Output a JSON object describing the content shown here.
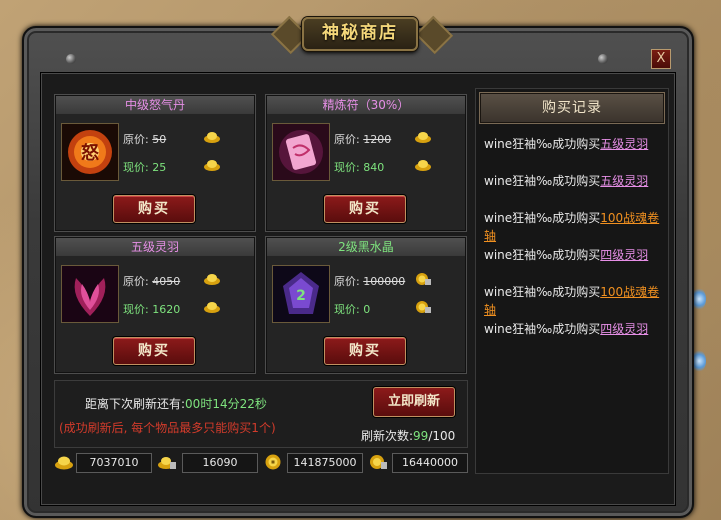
{
  "window": {
    "title": "神秘商店",
    "close_label": "X"
  },
  "shop_items": [
    {
      "name": "中级怒气丹",
      "orig_label": "原价:",
      "orig_price": "50",
      "now_label": "现价:",
      "now_price": "25",
      "currency": "gold-ingot-icon",
      "buy_label": "购买"
    },
    {
      "name": "精炼符（30%）",
      "orig_label": "原价:",
      "orig_price": "1200",
      "now_label": "现价:",
      "now_price": "840",
      "currency": "gold-ingot-icon",
      "buy_label": "购买"
    },
    {
      "name": "五级灵羽",
      "orig_label": "原价:",
      "orig_price": "4050",
      "now_label": "现价:",
      "now_price": "1620",
      "currency": "gold-ingot-icon",
      "buy_label": "购买"
    },
    {
      "name": "2级黑水晶",
      "orig_label": "原价:",
      "orig_price": "100000",
      "now_label": "现价:",
      "now_price": "0",
      "currency": "locked-coin-icon",
      "buy_label": "购买"
    }
  ],
  "refresh": {
    "countdown_label": "距离下次刷新还有:",
    "countdown_value": "00时14分22秒",
    "note": "(成功刷新后, 每个物品最多只能购买1个)",
    "button_label": "立即刷新",
    "count_label": "刷新次数:",
    "count_current": "99",
    "count_total": "/100"
  },
  "balances": [
    {
      "icon": "gold-ingot-icon",
      "value": "7037010"
    },
    {
      "icon": "locked-gold-ingot-icon",
      "value": "16090"
    },
    {
      "icon": "coin-icon",
      "value": "141875000"
    },
    {
      "icon": "locked-coin-icon",
      "value": "16440000"
    }
  ],
  "purchase_log": {
    "title": "购买记录",
    "entries": [
      {
        "user": "wine狂袖‰",
        "action": "成功购买",
        "item": "五级灵羽",
        "item_color": "#e68fe6"
      },
      {
        "user": "wine狂袖‰",
        "action": "成功购买",
        "item": "五级灵羽",
        "item_color": "#e68fe6"
      },
      {
        "user": "wine狂袖‰",
        "action": "成功购买",
        "item": "100战魂卷轴",
        "item_color": "#f09020"
      },
      {
        "user": "wine狂袖‰",
        "action": "成功购买",
        "item": "四级灵羽",
        "item_color": "#e68fe6"
      },
      {
        "user": "wine狂袖‰",
        "action": "成功购买",
        "item": "100战魂卷轴",
        "item_color": "#f09020"
      },
      {
        "user": "wine狂袖‰",
        "action": "成功购买",
        "item": "四级灵羽",
        "item_color": "#e68fe6"
      }
    ]
  },
  "colors": {
    "accent_title": "#f4d77a",
    "price_now": "#7ee37e",
    "item_purple": "#e68fe6",
    "button_red": "#8c1a1a",
    "note_red": "#d23b2b"
  }
}
